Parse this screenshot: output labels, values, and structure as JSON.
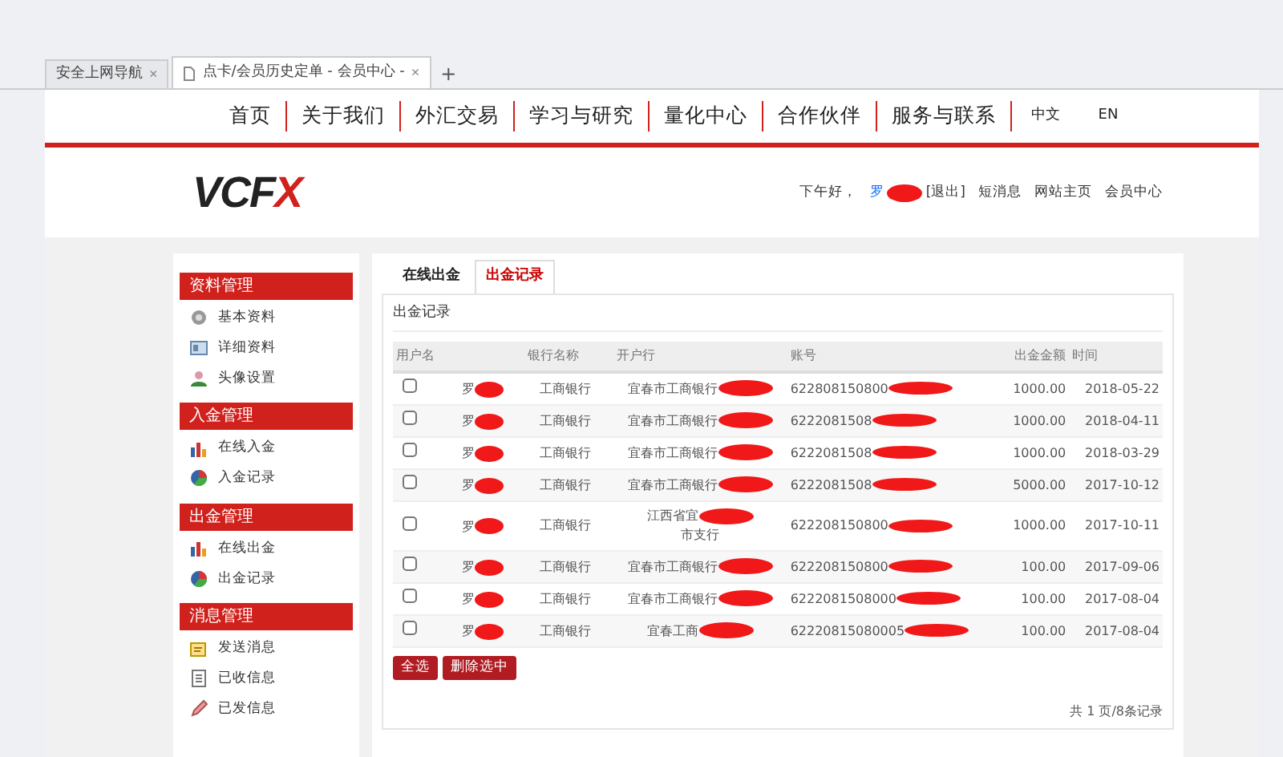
{
  "browser_tabs": [
    {
      "label": "安全上网导航",
      "close": "×",
      "selected": false
    },
    {
      "label": "点卡/会员历史定单 - 会员中心 -",
      "close": "×",
      "selected": true
    }
  ],
  "new_tab": "+",
  "nav": {
    "items": [
      "首页",
      "关于我们",
      "外汇交易",
      "学习与研究",
      "量化中心",
      "合作伙伴",
      "服务与联系"
    ],
    "languages": [
      "中文",
      "EN"
    ]
  },
  "header": {
    "logo": "VCFX",
    "greeting": "下午好，",
    "user": "罗",
    "logout": "[退出]",
    "links": [
      "短消息",
      "网站主页",
      "会员中心"
    ]
  },
  "sidebar": [
    {
      "title": "资料管理",
      "items": [
        {
          "label": "基本资料",
          "kind": "gear"
        },
        {
          "label": "详细资料",
          "kind": "card"
        },
        {
          "label": "头像设置",
          "kind": "person"
        }
      ]
    },
    {
      "title": "入金管理",
      "items": [
        {
          "label": "在线入金",
          "kind": "bars"
        },
        {
          "label": "入金记录",
          "kind": "pie"
        }
      ]
    },
    {
      "title": "出金管理",
      "items": [
        {
          "label": "在线出金",
          "kind": "bars"
        },
        {
          "label": "出金记录",
          "kind": "pie"
        }
      ]
    },
    {
      "title": "消息管理",
      "items": [
        {
          "label": "发送消息",
          "kind": "note"
        },
        {
          "label": "已收信息",
          "kind": "doc"
        },
        {
          "label": "已发信息",
          "kind": "pen"
        }
      ]
    }
  ],
  "tabs": [
    {
      "label": "在线出金",
      "selected": false
    },
    {
      "label": "出金记录",
      "selected": true
    }
  ],
  "panel_title": "出金记录",
  "table": {
    "columns": [
      "用户名",
      "银行名称",
      "开户行",
      "账号",
      "出金金额",
      "时间"
    ],
    "rows": [
      {
        "checked": false,
        "user": "罗",
        "bank": "工商银行",
        "branch": [
          "宜春市工商银行"
        ],
        "account": "622808150800",
        "amount": "1000.00",
        "time": "2018-05-22"
      },
      {
        "checked": false,
        "user": "罗",
        "bank": "工商银行",
        "branch": [
          "宜春市工商银行"
        ],
        "account": "6222081508",
        "amount": "1000.00",
        "time": "2018-04-11"
      },
      {
        "checked": false,
        "user": "罗",
        "bank": "工商银行",
        "branch": [
          "宜春市工商银行"
        ],
        "account": "6222081508",
        "amount": "1000.00",
        "time": "2018-03-29"
      },
      {
        "checked": false,
        "user": "罗",
        "bank": "工商银行",
        "branch": [
          "宜春市工商银行"
        ],
        "account": "6222081508",
        "amount": "5000.00",
        "time": "2017-10-12"
      },
      {
        "checked": false,
        "user": "罗",
        "bank": "工商银行",
        "branch": [
          "江西省宜",
          "市支行"
        ],
        "account": "622208150800",
        "amount": "1000.00",
        "time": "2017-10-11"
      },
      {
        "checked": false,
        "user": "罗",
        "bank": "工商银行",
        "branch": [
          "宜春市工商银行"
        ],
        "account": "622208150800",
        "amount": "100.00",
        "time": "2017-09-06"
      },
      {
        "checked": false,
        "user": "罗",
        "bank": "工商银行",
        "branch": [
          "宜春市工商银行"
        ],
        "account": "6222081508000",
        "amount": "100.00",
        "time": "2017-08-04"
      },
      {
        "checked": false,
        "user": "罗",
        "bank": "工商银行",
        "branch": [
          "宜春工商"
        ],
        "account": "62220815080005",
        "amount": "100.00",
        "time": "2017-08-04"
      }
    ]
  },
  "buttons": [
    "全选",
    "删除选中"
  ],
  "pagination": "共 1 页/8条记录"
}
